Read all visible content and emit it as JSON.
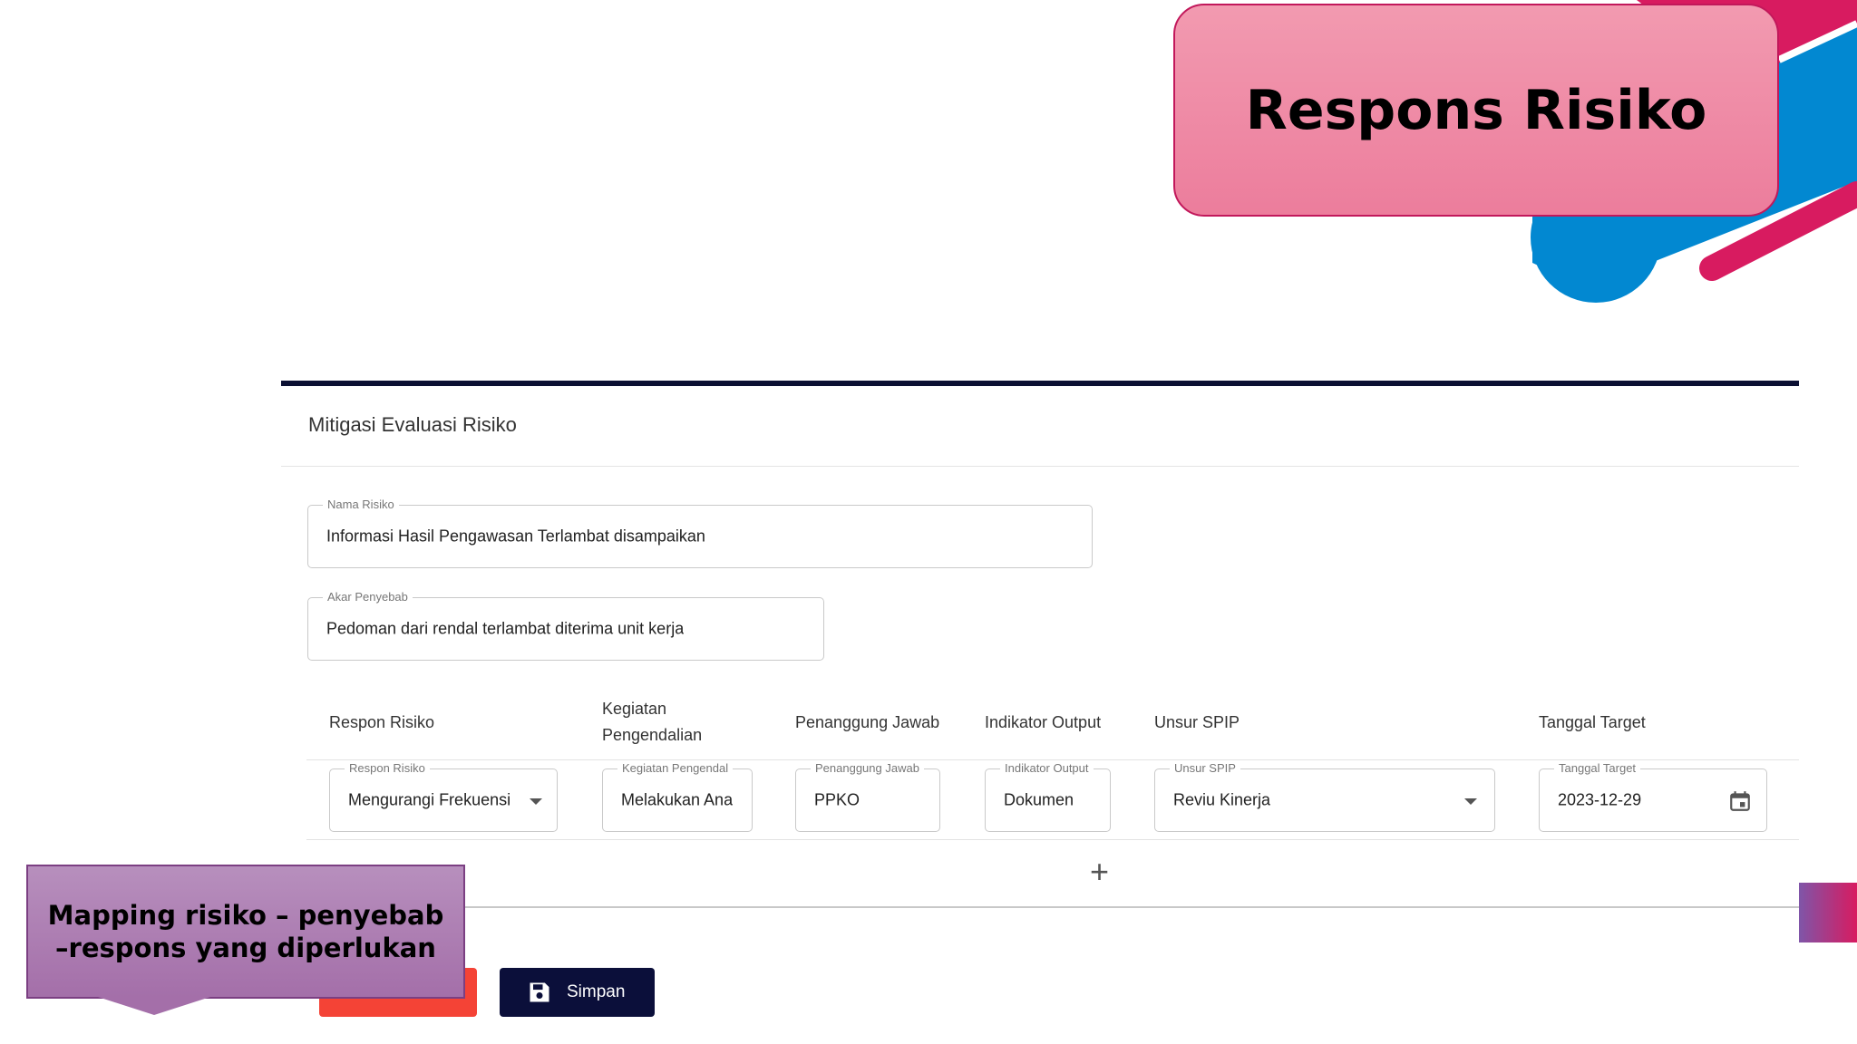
{
  "slide": {
    "title": "Respons Risiko",
    "callout": "Mapping risiko – penyebab –respons yang diperlukan",
    "colors": {
      "pink": "#d81b60",
      "blue": "#0288d1",
      "navy": "#0b0f3a",
      "red": "#f44336"
    }
  },
  "form": {
    "title": "Mitigasi Evaluasi Risiko",
    "nama_risiko": {
      "label": "Nama Risiko",
      "value": "Informasi Hasil Pengawasan Terlambat disampaikan"
    },
    "akar_penyebab": {
      "label": "Akar Penyebab",
      "value": "Pedoman dari rendal terlambat diterima unit kerja"
    },
    "table": {
      "headers": {
        "respon": "Respon Risiko",
        "kegiatan_line1": "Kegiatan",
        "kegiatan_line2": "Pengendalian",
        "penanggung": "Penanggung Jawab",
        "indikator": "Indikator Output",
        "unsur": "Unsur SPIP",
        "tanggal": "Tanggal Target"
      },
      "row": {
        "respon": {
          "label": "Respon Risiko",
          "value": "Mengurangi Frekuensi"
        },
        "kegiatan": {
          "label": "Kegiatan Pengendal",
          "value": "Melakukan Ana"
        },
        "penanggung": {
          "label": "Penanggung Jawab",
          "value": "PPKO"
        },
        "indikator": {
          "label": "Indikator Output",
          "value": "Dokumen"
        },
        "unsur": {
          "label": "Unsur SPIP",
          "value": "Reviu Kinerja"
        },
        "tanggal": {
          "label": "Tanggal Target",
          "value": "2023-12-29"
        }
      },
      "add_symbol": "+"
    },
    "buttons": {
      "save": "Simpan"
    },
    "icons": {
      "add": "plus-icon",
      "save": "save-icon",
      "calendar": "calendar-icon",
      "dropdown": "chevron-down-icon"
    }
  }
}
